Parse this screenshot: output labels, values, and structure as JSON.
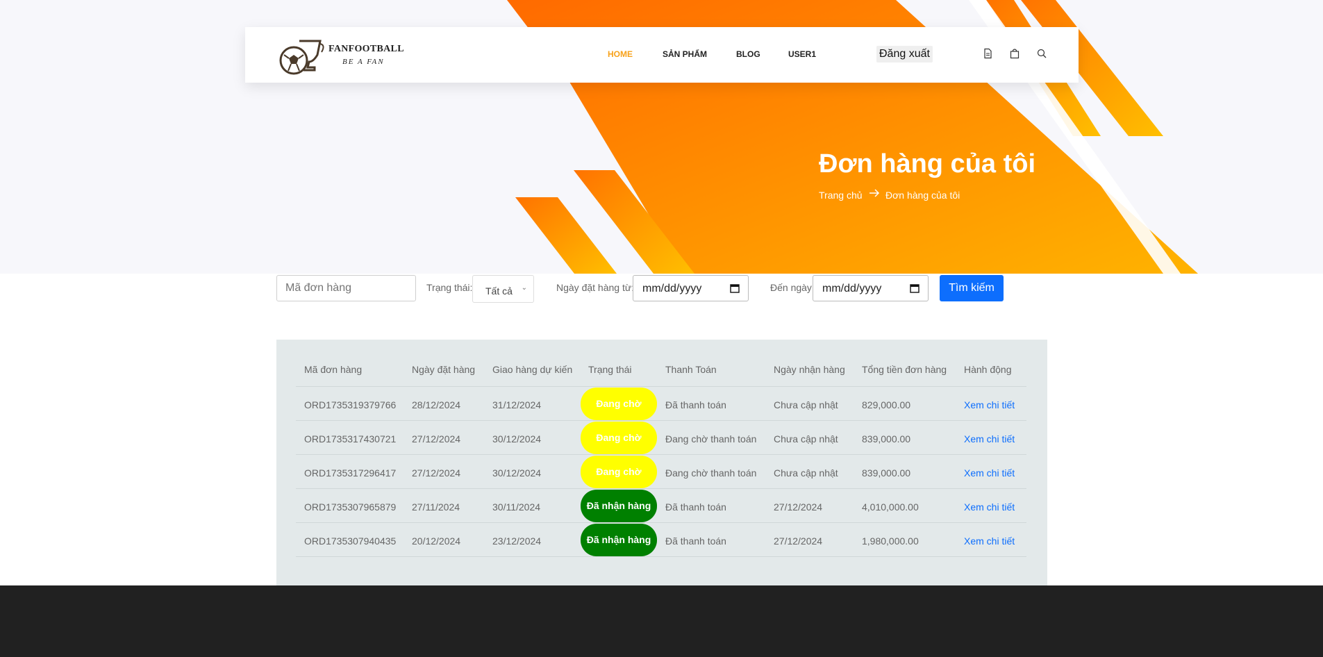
{
  "header": {
    "brand": "FANFOOTBALL",
    "tagline": "BE A FAN",
    "nav": [
      "HOME",
      "SẢN PHẨM",
      "BLOG",
      "USER1"
    ],
    "logout_label": "Đăng xuất",
    "icons": [
      "document-icon",
      "shopping-bag-icon",
      "search-icon"
    ]
  },
  "hero": {
    "title": "Đơn hàng của tôi",
    "breadcrumb": [
      "Trang chủ",
      "Đơn hàng của tôi"
    ]
  },
  "filters": {
    "order_code_placeholder": "Mã đơn hàng",
    "status_label": "Trạng thái:",
    "status_value": "Tất cả",
    "from_label": "Ngày đặt hàng từ:",
    "from_value": "mm/dd/yyyy",
    "to_label": "Đến ngày:",
    "to_value": "mm/dd/yyyy",
    "search_button": "Tìm kiếm"
  },
  "table": {
    "columns": [
      "Mã đơn hàng",
      "Ngày đặt hàng",
      "Giao hàng dự kiến",
      "Trạng thái",
      "Thanh Toán",
      "Ngày nhận hàng",
      "Tổng tiền đơn hàng",
      "Hành động"
    ],
    "rows": [
      {
        "code": "ORD1735319379766",
        "order_date": "28/12/2024",
        "expected": "31/12/2024",
        "status": "Đang chờ",
        "payment": "Đã thanh toán",
        "received": "Chưa cập nhật",
        "total": "829,000.00",
        "action": "Xem chi tiết"
      },
      {
        "code": "ORD1735317430721",
        "order_date": "27/12/2024",
        "expected": "30/12/2024",
        "status": "Đang chờ",
        "payment": "Đang chờ thanh toán",
        "received": "Chưa cập nhật",
        "total": "839,000.00",
        "action": "Xem chi tiết"
      },
      {
        "code": "ORD1735317296417",
        "order_date": "27/12/2024",
        "expected": "30/12/2024",
        "status": "Đang chờ",
        "payment": "Đang chờ thanh toán",
        "received": "Chưa cập nhật",
        "total": "839,000.00",
        "action": "Xem chi tiết"
      },
      {
        "code": "ORD1735307965879",
        "order_date": "27/11/2024",
        "expected": "30/11/2024",
        "status": "Đã nhận hàng",
        "payment": "Đã thanh toán",
        "received": "27/12/2024",
        "total": "4,010,000.00",
        "action": "Xem chi tiết"
      },
      {
        "code": "ORD1735307940435",
        "order_date": "20/12/2024",
        "expected": "23/12/2024",
        "status": "Đã nhận hàng",
        "payment": "Đã thanh toán",
        "received": "27/12/2024",
        "total": "1,980,000.00",
        "action": "Xem chi tiết"
      }
    ]
  },
  "colors": {
    "accent": "#f7a21b",
    "orange": "#ff7a00",
    "link": "#0d6efd",
    "pending": "#ffff00",
    "delivered": "#008000",
    "footer": "#212121"
  }
}
